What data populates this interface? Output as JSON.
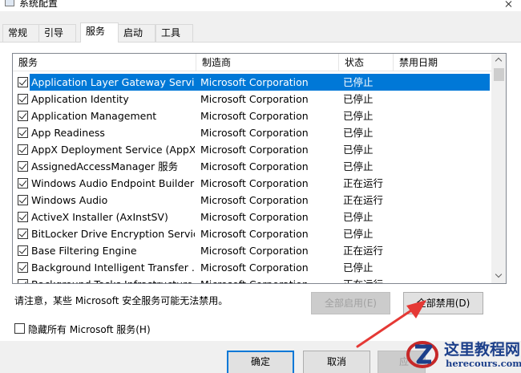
{
  "window": {
    "title": "系统配置"
  },
  "tabs": [
    {
      "label": "常规"
    },
    {
      "label": "引导"
    },
    {
      "label": "服务"
    },
    {
      "label": "启动"
    },
    {
      "label": "工具"
    }
  ],
  "columns": {
    "service": "服务",
    "manufacturer": "制造商",
    "status": "状态",
    "disabled_date": "禁用日期"
  },
  "services": [
    {
      "name": "Application Layer Gateway Service",
      "manufacturer": "Microsoft Corporation",
      "status": "已停止",
      "checked": true,
      "selected": true
    },
    {
      "name": "Application Identity",
      "manufacturer": "Microsoft Corporation",
      "status": "已停止",
      "checked": true
    },
    {
      "name": "Application Management",
      "manufacturer": "Microsoft Corporation",
      "status": "已停止",
      "checked": true
    },
    {
      "name": "App Readiness",
      "manufacturer": "Microsoft Corporation",
      "status": "已停止",
      "checked": true
    },
    {
      "name": "AppX Deployment Service (AppX...",
      "manufacturer": "Microsoft Corporation",
      "status": "已停止",
      "checked": true
    },
    {
      "name": "AssignedAccessManager 服务",
      "manufacturer": "Microsoft Corporation",
      "status": "已停止",
      "checked": true
    },
    {
      "name": "Windows Audio Endpoint Builder",
      "manufacturer": "Microsoft Corporation",
      "status": "正在运行",
      "checked": true
    },
    {
      "name": "Windows Audio",
      "manufacturer": "Microsoft Corporation",
      "status": "正在运行",
      "checked": true
    },
    {
      "name": "ActiveX Installer (AxInstSV)",
      "manufacturer": "Microsoft Corporation",
      "status": "已停止",
      "checked": true
    },
    {
      "name": "BitLocker Drive Encryption Service",
      "manufacturer": "Microsoft Corporation",
      "status": "已停止",
      "checked": true
    },
    {
      "name": "Base Filtering Engine",
      "manufacturer": "Microsoft Corporation",
      "status": "正在运行",
      "checked": true
    },
    {
      "name": "Background Intelligent Transfer ...",
      "manufacturer": "Microsoft Corporation",
      "status": "已停止",
      "checked": true
    },
    {
      "name": "Background Tasks Infrastructure",
      "manufacturer": "Microsoft Corporation",
      "status": "正在运行",
      "checked": true
    }
  ],
  "note": "请注意，某些 Microsoft 安全服务可能无法禁用。",
  "buttons": {
    "enable_all": "全部启用(E)",
    "disable_all": "全部禁用(D)",
    "ok": "确定",
    "cancel": "取消",
    "apply": "应"
  },
  "hide_ms_label": "隐藏所有 Microsoft 服务(H)",
  "watermark": {
    "title": "这里教程网",
    "url": "herecours.com"
  },
  "colors": {
    "selection": "#0078d7",
    "arrow": "#e53935",
    "watermark": "#1c3f8a"
  }
}
